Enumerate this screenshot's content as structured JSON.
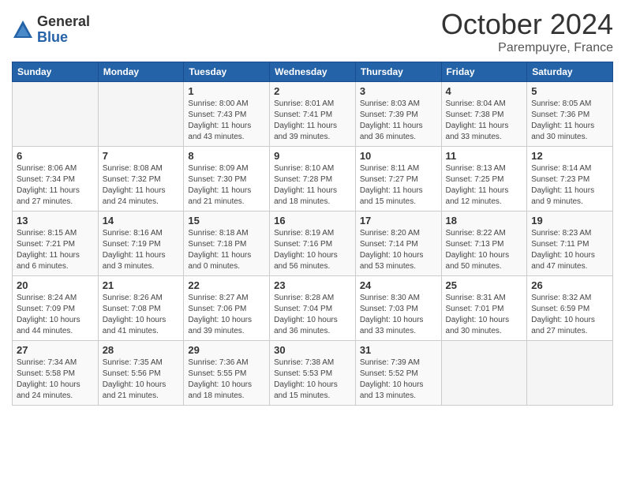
{
  "header": {
    "logo_general": "General",
    "logo_blue": "Blue",
    "month_title": "October 2024",
    "location": "Parempuyre, France"
  },
  "weekdays": [
    "Sunday",
    "Monday",
    "Tuesday",
    "Wednesday",
    "Thursday",
    "Friday",
    "Saturday"
  ],
  "weeks": [
    [
      {
        "day": "",
        "sunrise": "",
        "sunset": "",
        "daylight": ""
      },
      {
        "day": "",
        "sunrise": "",
        "sunset": "",
        "daylight": ""
      },
      {
        "day": "1",
        "sunrise": "Sunrise: 8:00 AM",
        "sunset": "Sunset: 7:43 PM",
        "daylight": "Daylight: 11 hours and 43 minutes."
      },
      {
        "day": "2",
        "sunrise": "Sunrise: 8:01 AM",
        "sunset": "Sunset: 7:41 PM",
        "daylight": "Daylight: 11 hours and 39 minutes."
      },
      {
        "day": "3",
        "sunrise": "Sunrise: 8:03 AM",
        "sunset": "Sunset: 7:39 PM",
        "daylight": "Daylight: 11 hours and 36 minutes."
      },
      {
        "day": "4",
        "sunrise": "Sunrise: 8:04 AM",
        "sunset": "Sunset: 7:38 PM",
        "daylight": "Daylight: 11 hours and 33 minutes."
      },
      {
        "day": "5",
        "sunrise": "Sunrise: 8:05 AM",
        "sunset": "Sunset: 7:36 PM",
        "daylight": "Daylight: 11 hours and 30 minutes."
      }
    ],
    [
      {
        "day": "6",
        "sunrise": "Sunrise: 8:06 AM",
        "sunset": "Sunset: 7:34 PM",
        "daylight": "Daylight: 11 hours and 27 minutes."
      },
      {
        "day": "7",
        "sunrise": "Sunrise: 8:08 AM",
        "sunset": "Sunset: 7:32 PM",
        "daylight": "Daylight: 11 hours and 24 minutes."
      },
      {
        "day": "8",
        "sunrise": "Sunrise: 8:09 AM",
        "sunset": "Sunset: 7:30 PM",
        "daylight": "Daylight: 11 hours and 21 minutes."
      },
      {
        "day": "9",
        "sunrise": "Sunrise: 8:10 AM",
        "sunset": "Sunset: 7:28 PM",
        "daylight": "Daylight: 11 hours and 18 minutes."
      },
      {
        "day": "10",
        "sunrise": "Sunrise: 8:11 AM",
        "sunset": "Sunset: 7:27 PM",
        "daylight": "Daylight: 11 hours and 15 minutes."
      },
      {
        "day": "11",
        "sunrise": "Sunrise: 8:13 AM",
        "sunset": "Sunset: 7:25 PM",
        "daylight": "Daylight: 11 hours and 12 minutes."
      },
      {
        "day": "12",
        "sunrise": "Sunrise: 8:14 AM",
        "sunset": "Sunset: 7:23 PM",
        "daylight": "Daylight: 11 hours and 9 minutes."
      }
    ],
    [
      {
        "day": "13",
        "sunrise": "Sunrise: 8:15 AM",
        "sunset": "Sunset: 7:21 PM",
        "daylight": "Daylight: 11 hours and 6 minutes."
      },
      {
        "day": "14",
        "sunrise": "Sunrise: 8:16 AM",
        "sunset": "Sunset: 7:19 PM",
        "daylight": "Daylight: 11 hours and 3 minutes."
      },
      {
        "day": "15",
        "sunrise": "Sunrise: 8:18 AM",
        "sunset": "Sunset: 7:18 PM",
        "daylight": "Daylight: 11 hours and 0 minutes."
      },
      {
        "day": "16",
        "sunrise": "Sunrise: 8:19 AM",
        "sunset": "Sunset: 7:16 PM",
        "daylight": "Daylight: 10 hours and 56 minutes."
      },
      {
        "day": "17",
        "sunrise": "Sunrise: 8:20 AM",
        "sunset": "Sunset: 7:14 PM",
        "daylight": "Daylight: 10 hours and 53 minutes."
      },
      {
        "day": "18",
        "sunrise": "Sunrise: 8:22 AM",
        "sunset": "Sunset: 7:13 PM",
        "daylight": "Daylight: 10 hours and 50 minutes."
      },
      {
        "day": "19",
        "sunrise": "Sunrise: 8:23 AM",
        "sunset": "Sunset: 7:11 PM",
        "daylight": "Daylight: 10 hours and 47 minutes."
      }
    ],
    [
      {
        "day": "20",
        "sunrise": "Sunrise: 8:24 AM",
        "sunset": "Sunset: 7:09 PM",
        "daylight": "Daylight: 10 hours and 44 minutes."
      },
      {
        "day": "21",
        "sunrise": "Sunrise: 8:26 AM",
        "sunset": "Sunset: 7:08 PM",
        "daylight": "Daylight: 10 hours and 41 minutes."
      },
      {
        "day": "22",
        "sunrise": "Sunrise: 8:27 AM",
        "sunset": "Sunset: 7:06 PM",
        "daylight": "Daylight: 10 hours and 39 minutes."
      },
      {
        "day": "23",
        "sunrise": "Sunrise: 8:28 AM",
        "sunset": "Sunset: 7:04 PM",
        "daylight": "Daylight: 10 hours and 36 minutes."
      },
      {
        "day": "24",
        "sunrise": "Sunrise: 8:30 AM",
        "sunset": "Sunset: 7:03 PM",
        "daylight": "Daylight: 10 hours and 33 minutes."
      },
      {
        "day": "25",
        "sunrise": "Sunrise: 8:31 AM",
        "sunset": "Sunset: 7:01 PM",
        "daylight": "Daylight: 10 hours and 30 minutes."
      },
      {
        "day": "26",
        "sunrise": "Sunrise: 8:32 AM",
        "sunset": "Sunset: 6:59 PM",
        "daylight": "Daylight: 10 hours and 27 minutes."
      }
    ],
    [
      {
        "day": "27",
        "sunrise": "Sunrise: 7:34 AM",
        "sunset": "Sunset: 5:58 PM",
        "daylight": "Daylight: 10 hours and 24 minutes."
      },
      {
        "day": "28",
        "sunrise": "Sunrise: 7:35 AM",
        "sunset": "Sunset: 5:56 PM",
        "daylight": "Daylight: 10 hours and 21 minutes."
      },
      {
        "day": "29",
        "sunrise": "Sunrise: 7:36 AM",
        "sunset": "Sunset: 5:55 PM",
        "daylight": "Daylight: 10 hours and 18 minutes."
      },
      {
        "day": "30",
        "sunrise": "Sunrise: 7:38 AM",
        "sunset": "Sunset: 5:53 PM",
        "daylight": "Daylight: 10 hours and 15 minutes."
      },
      {
        "day": "31",
        "sunrise": "Sunrise: 7:39 AM",
        "sunset": "Sunset: 5:52 PM",
        "daylight": "Daylight: 10 hours and 13 minutes."
      },
      {
        "day": "",
        "sunrise": "",
        "sunset": "",
        "daylight": ""
      },
      {
        "day": "",
        "sunrise": "",
        "sunset": "",
        "daylight": ""
      }
    ]
  ]
}
